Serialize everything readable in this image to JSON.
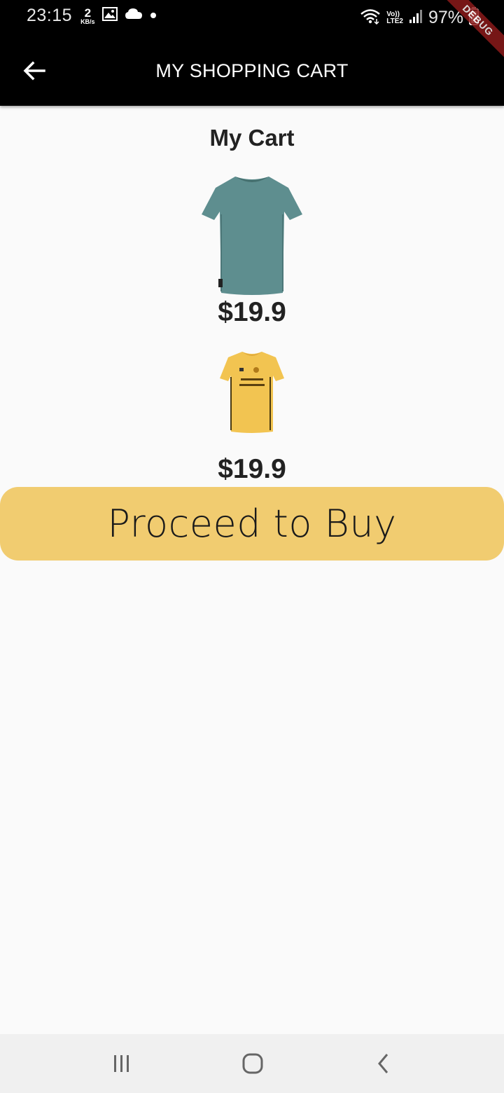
{
  "status_bar": {
    "time": "23:15",
    "data_speed_value": "2",
    "data_speed_unit": "KB/s",
    "volte_top": "Vo))",
    "volte_bottom": "LTE2",
    "battery": "97%"
  },
  "debug_banner": "DEBUG",
  "app_bar": {
    "title": "MY SHOPPING CART"
  },
  "cart": {
    "heading": "My Cart",
    "items": [
      {
        "name": "teal t-shirt",
        "price": "$19.9",
        "color": "#5e8e8f"
      },
      {
        "name": "yellow jersey",
        "price": "$19.9",
        "color": "#f2c451"
      }
    ]
  },
  "proceed_button_label": "Proceed to Buy",
  "colors": {
    "app_bar": "#000000",
    "background": "#fafafa",
    "button": "#f1cc70"
  }
}
